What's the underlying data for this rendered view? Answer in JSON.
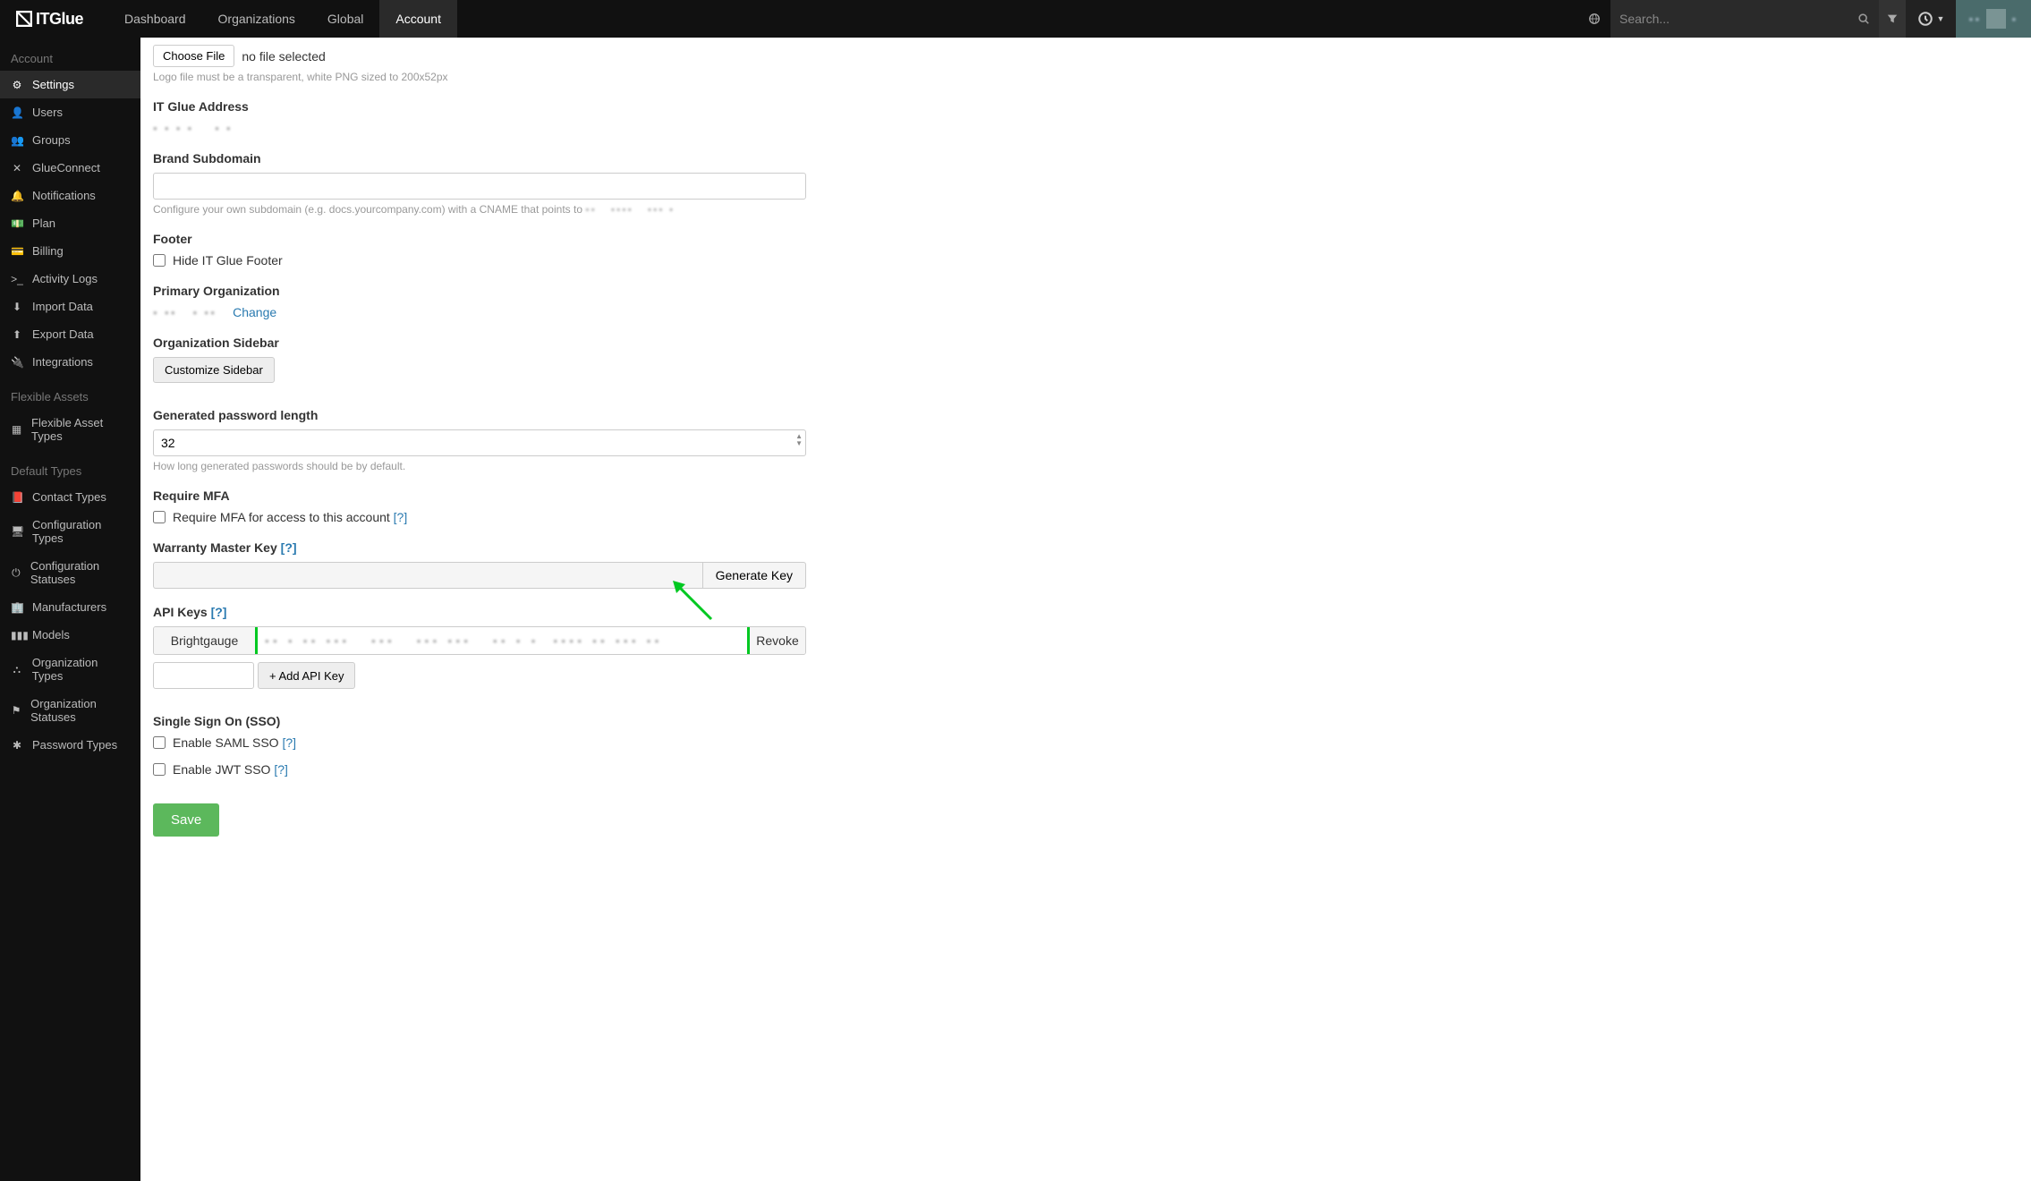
{
  "brand": "ITGlue",
  "topnav": {
    "dashboard": "Dashboard",
    "organizations": "Organizations",
    "global": "Global",
    "account": "Account"
  },
  "search": {
    "placeholder": "Search..."
  },
  "sidebar": {
    "header_account": "Account",
    "settings": "Settings",
    "users": "Users",
    "groups": "Groups",
    "glueconnect": "GlueConnect",
    "notifications": "Notifications",
    "plan": "Plan",
    "billing": "Billing",
    "activity_logs": "Activity Logs",
    "import_data": "Import Data",
    "export_data": "Export Data",
    "integrations": "Integrations",
    "header_flex": "Flexible Assets",
    "flex_types": "Flexible Asset Types",
    "header_default": "Default Types",
    "contact_types": "Contact Types",
    "config_types": "Configuration Types",
    "config_statuses": "Configuration Statuses",
    "manufacturers": "Manufacturers",
    "models": "Models",
    "org_types": "Organization Types",
    "org_statuses": "Organization Statuses",
    "password_types": "Password Types"
  },
  "form": {
    "choose_file": "Choose File",
    "no_file": "no file selected",
    "logo_help": "Logo file must be a transparent, white PNG sized to 200x52px",
    "itglue_address_label": "IT Glue Address",
    "brand_subdomain_label": "Brand Subdomain",
    "brand_subdomain_value": "",
    "subdomain_help_prefix": "Configure your own subdomain (e.g. docs.yourcompany.com) with a CNAME that points to ",
    "footer_label": "Footer",
    "hide_footer": "Hide IT Glue Footer",
    "primary_org_label": "Primary Organization",
    "change": "Change",
    "org_sidebar_label": "Organization Sidebar",
    "customize_sidebar": "Customize Sidebar",
    "pw_length_label": "Generated password length",
    "pw_length_value": "32",
    "pw_length_help": "How long generated passwords should be by default.",
    "require_mfa_label": "Require MFA",
    "require_mfa_check": "Require MFA for access to this account",
    "warranty_label": "Warranty Master Key",
    "generate_key": "Generate Key",
    "api_keys_label": "API Keys",
    "api_key_name": "Brightgauge",
    "api_revoke": "Revoke",
    "add_api": "+ Add API Key",
    "sso_label": "Single Sign On (SSO)",
    "enable_saml": "Enable SAML SSO",
    "enable_jwt": "Enable JWT SSO",
    "help_q": "[?]",
    "save": "Save"
  }
}
